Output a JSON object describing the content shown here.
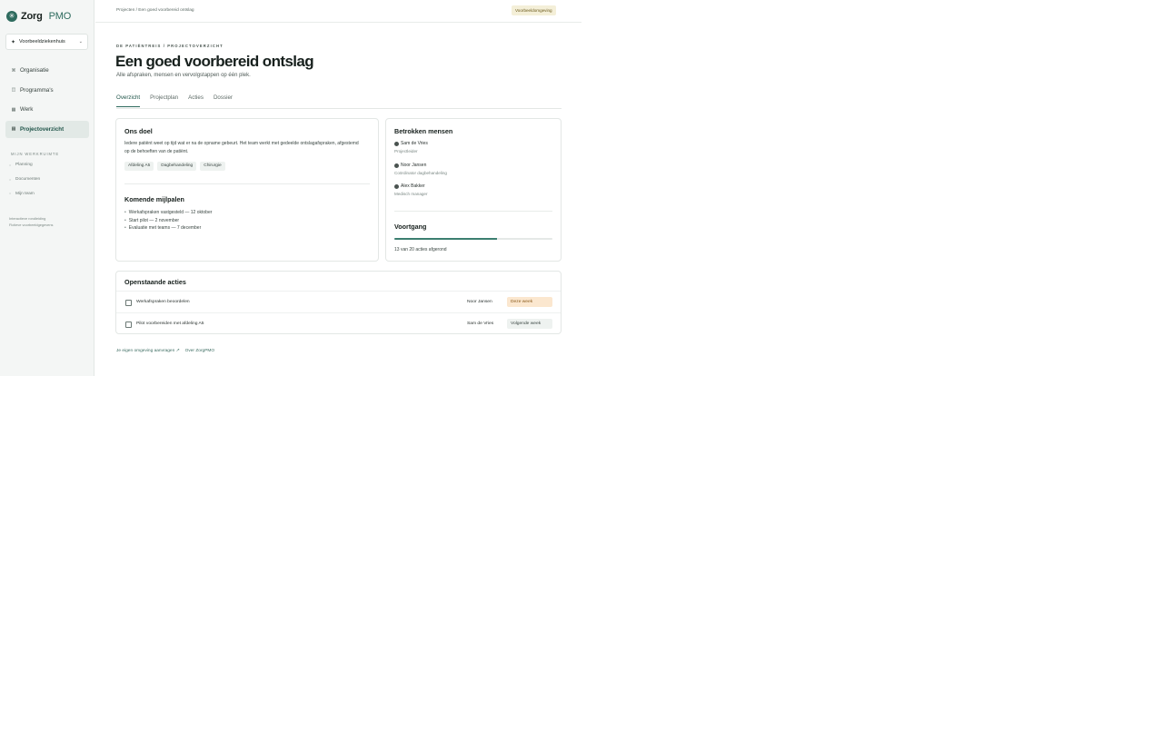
{
  "brand": {
    "logo": "✳",
    "name_a": "Zorg",
    "name_b": "PMO"
  },
  "org": {
    "icon": "✦",
    "value": "Voorbeeldziekenhuis",
    "chevron": "⌄"
  },
  "nav": [
    {
      "label": "Organisatie",
      "icon": "⌘",
      "active": false
    },
    {
      "label": "Programma's",
      "icon": "◫",
      "active": false
    },
    {
      "label": "Werk",
      "icon": "▦",
      "active": false
    },
    {
      "label": "Projectoverzicht",
      "icon": "▤",
      "active": true
    }
  ],
  "workspace": {
    "label": "MIJN WERKRUIMTE",
    "items": [
      {
        "label": "Planning"
      },
      {
        "label": "Documenten"
      },
      {
        "label": "Mijn team"
      }
    ]
  },
  "sidebar_footer": {
    "line1": "Interactieve rondleiding",
    "line2": "Fictieve voorbeeldgegevens"
  },
  "topbar": {
    "breadcrumb": "Projecten / Een goed voorbereid ontslag",
    "env_badge": "Voorbeeldomgeving"
  },
  "header": {
    "eyebrow": "DE PATIËNTREIS / PROJECTOVERZICHT",
    "title": "Een goed voorbereid ontslag",
    "subtitle": "Alle afspraken, mensen en vervolgstappen op één plek."
  },
  "tabs": [
    {
      "label": "Overzicht",
      "active": true
    },
    {
      "label": "Projectplan",
      "active": false
    },
    {
      "label": "Acties",
      "active": false
    },
    {
      "label": "Dossier",
      "active": false
    }
  ],
  "goal": {
    "heading": "Ons doel",
    "text": "Iedere patiënt weet op tijd wat er na de opname gebeurt. Het team werkt met gedeelde ontslagafspraken, afgestemd op de behoeften van de patiënt.",
    "chips": [
      "Afdeling A5",
      "Dagbehandeling",
      "Chirurgie"
    ]
  },
  "milestones": {
    "heading": "Komende mijlpalen",
    "items": [
      "Werkafspraken vastgesteld — 12 oktober",
      "Start pilot — 2 november",
      "Evaluatie met teams — 7 december"
    ]
  },
  "people": {
    "heading": "Betrokken mensen",
    "items": [
      {
        "name": "Sam de Vries",
        "role": "Projectleider"
      },
      {
        "name": "Noor Jansen",
        "role": "Coördinator dagbehandeling"
      },
      {
        "name": "Alex Bakker",
        "role": "Medisch manager"
      }
    ]
  },
  "progress": {
    "heading": "Voortgang",
    "fraction": 0.65,
    "label": "13 van 20 acties afgerond",
    "color": "#3c7f70"
  },
  "open_actions": {
    "heading": "Openstaande acties",
    "rows": [
      {
        "label": "Werkafspraken beoordelen",
        "owner": "Noor Jansen",
        "due": "Deze week",
        "due_bg": "#fbe7cf",
        "due_fg": "#8a5a1a"
      },
      {
        "label": "Pilot voorbereiden met afdeling A5",
        "owner": "Sam de Vries",
        "due": "Volgende week",
        "due_bg": "#eef2f0",
        "due_fg": "#3b4743"
      }
    ]
  },
  "footer_links": {
    "link1": "Je eigen omgeving aanvragen ↗",
    "link2": "Over ZorgPMO"
  }
}
